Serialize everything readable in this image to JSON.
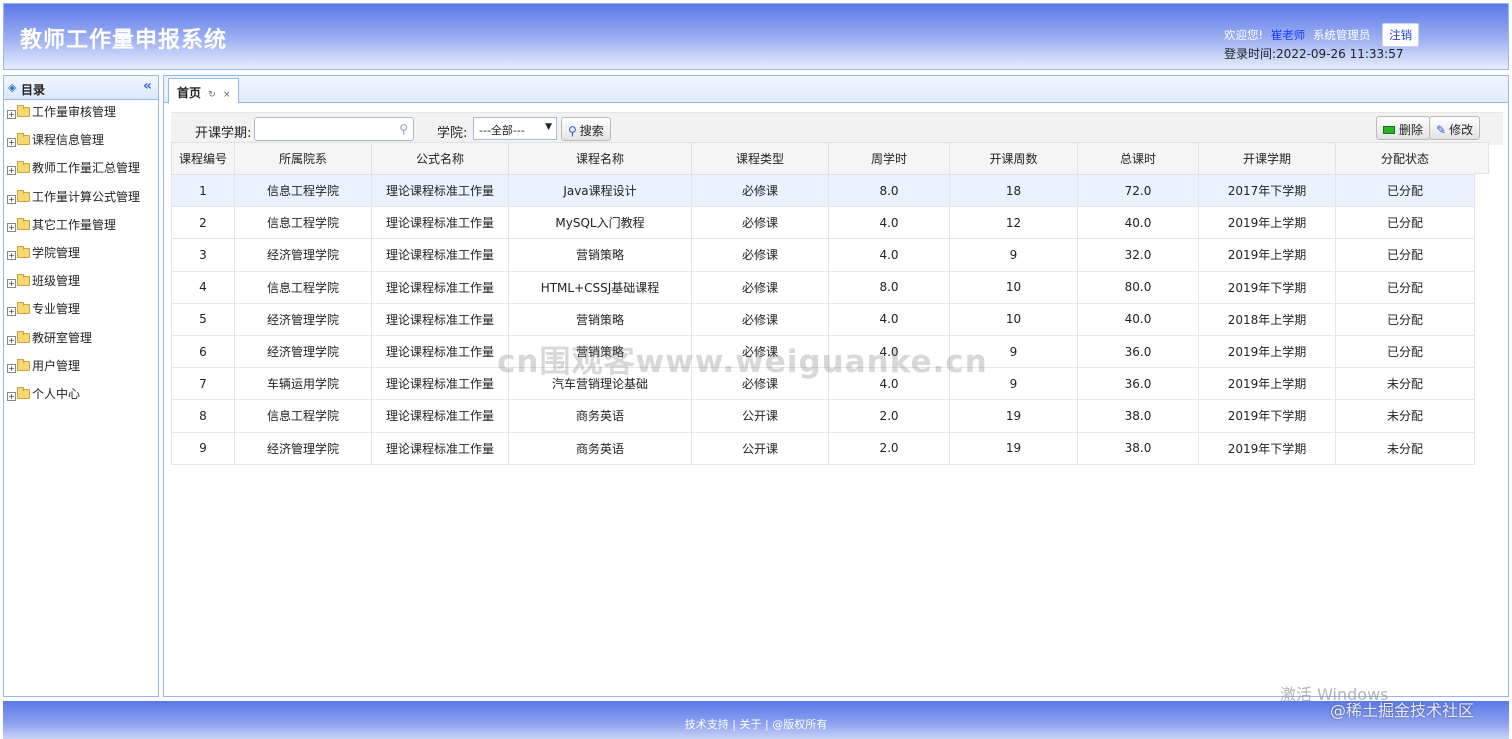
{
  "header": {
    "title": "教师工作量申报系统",
    "welcome": "欢迎您!",
    "username": "崔老师",
    "role": "系统管理员",
    "logout": "注销",
    "login_time": "登录时间:2022-09-26 11:33:57"
  },
  "sidebar": {
    "title": "目录",
    "collapse_icon": "«",
    "items": [
      {
        "label": "工作量审核管理"
      },
      {
        "label": "课程信息管理"
      },
      {
        "label": "教师工作量汇总管理"
      },
      {
        "label": "工作量计算公式管理"
      },
      {
        "label": "其它工作量管理"
      },
      {
        "label": "学院管理"
      },
      {
        "label": "班级管理"
      },
      {
        "label": "专业管理"
      },
      {
        "label": "教研室管理"
      },
      {
        "label": "用户管理"
      },
      {
        "label": "个人中心"
      }
    ]
  },
  "tabs": [
    {
      "label": "首页",
      "refresh": "↻",
      "close": "×"
    }
  ],
  "toolbar": {
    "term_label": "开课学期:",
    "term_value": "",
    "college_label": "学院:",
    "college_selected": "---全部---",
    "search_label": "搜索",
    "delete_label": "删除",
    "edit_label": "修改"
  },
  "grid": {
    "columns": [
      "课程编号",
      "所属院系",
      "公式名称",
      "课程名称",
      "课程类型",
      "周学时",
      "开课周数",
      "总课时",
      "开课学期",
      "分配状态"
    ],
    "rows": [
      [
        "1",
        "信息工程学院",
        "理论课程标准工作量",
        "Java课程设计",
        "必修课",
        "8.0",
        "18",
        "72.0",
        "2017年下学期",
        "已分配"
      ],
      [
        "2",
        "信息工程学院",
        "理论课程标准工作量",
        "MySQL入门教程",
        "必修课",
        "4.0",
        "12",
        "40.0",
        "2019年上学期",
        "已分配"
      ],
      [
        "3",
        "经济管理学院",
        "理论课程标准工作量",
        "营销策略",
        "必修课",
        "4.0",
        "9",
        "32.0",
        "2019年上学期",
        "已分配"
      ],
      [
        "4",
        "信息工程学院",
        "理论课程标准工作量",
        "HTML+CSSJ基础课程",
        "必修课",
        "8.0",
        "10",
        "80.0",
        "2019年下学期",
        "已分配"
      ],
      [
        "5",
        "经济管理学院",
        "理论课程标准工作量",
        "营销策略",
        "必修课",
        "4.0",
        "10",
        "40.0",
        "2018年上学期",
        "已分配"
      ],
      [
        "6",
        "经济管理学院",
        "理论课程标准工作量",
        "营销策略",
        "必修课",
        "4.0",
        "9",
        "36.0",
        "2019年上学期",
        "已分配"
      ],
      [
        "7",
        "车辆运用学院",
        "理论课程标准工作量",
        "汽车营销理论基础",
        "必修课",
        "4.0",
        "9",
        "36.0",
        "2019年上学期",
        "未分配"
      ],
      [
        "8",
        "信息工程学院",
        "理论课程标准工作量",
        "商务英语",
        "公开课",
        "2.0",
        "19",
        "38.0",
        "2019年下学期",
        "未分配"
      ],
      [
        "9",
        "经济管理学院",
        "理论课程标准工作量",
        "商务英语",
        "公开课",
        "2.0",
        "19",
        "38.0",
        "2019年下学期",
        "未分配"
      ]
    ]
  },
  "watermark": "cn围观客www.weiguanke.cn",
  "footer": {
    "text": "技术支持 | 关于 | @版权所有"
  },
  "overlay": {
    "activate_windows": "激活 Windows",
    "community": "@稀土掘金技术社区"
  }
}
